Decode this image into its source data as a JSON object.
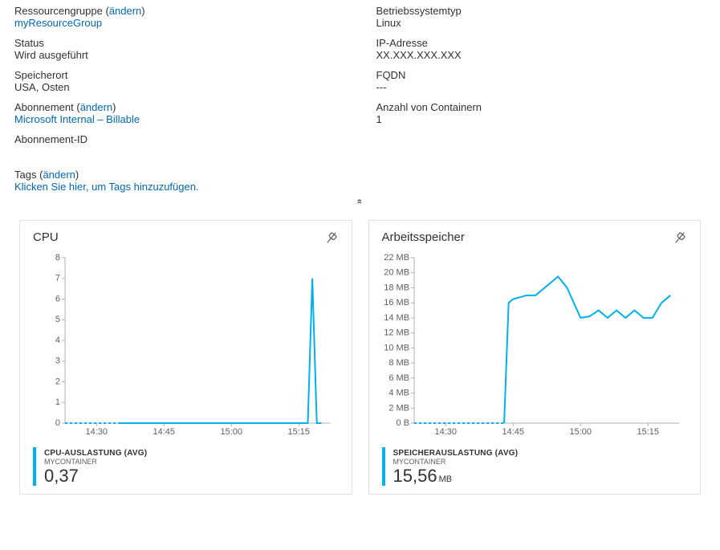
{
  "props_left": [
    {
      "label": "Ressourcengruppe",
      "action": "ändern",
      "value": "myResourceGroup",
      "valueIsLink": true
    },
    {
      "label": "Status",
      "value": "Wird ausgeführt"
    },
    {
      "label": "Speicherort",
      "value": "USA, Osten"
    },
    {
      "label": "Abonnement",
      "action": "ändern",
      "value": "Microsoft Internal – Billable",
      "valueIsLink": true
    },
    {
      "label": "Abonnement-ID",
      "value": " "
    }
  ],
  "props_right": [
    {
      "label": "Betriebssystemtyp",
      "value": "Linux"
    },
    {
      "label": "IP-Adresse",
      "value": "XX.XXX.XXX.XXX"
    },
    {
      "label": "FQDN",
      "value": "---"
    },
    {
      "label": "Anzahl von Containern",
      "value": "1"
    }
  ],
  "tags": {
    "label": "Tags",
    "action": "ändern",
    "cta": "Klicken Sie hier, um Tags hinzuzufügen."
  },
  "collapse_glyph": "«",
  "cards": {
    "cpu_title": "CPU",
    "mem_title": "Arbeitsspeicher"
  },
  "legend": {
    "cpu_metric": "CPU-AUSLASTUNG (AVG)",
    "cpu_sub": "MYCONTAINER",
    "cpu_value": "0,37",
    "mem_metric": "SPEICHERAUSLASTUNG (AVG)",
    "mem_sub": "MYCONTAINER",
    "mem_value": "15,56",
    "mem_unit": "MB"
  },
  "chart_data": [
    {
      "id": "cpu",
      "type": "line",
      "title": "CPU",
      "x_ticks": [
        "14:30",
        "14:45",
        "15:00",
        "15:15"
      ],
      "y_ticks": [
        0,
        1,
        2,
        3,
        4,
        5,
        6,
        7,
        8
      ],
      "ylim": [
        0,
        8
      ],
      "x": [
        "14:23",
        "14:25",
        "14:30",
        "14:35",
        "14:40",
        "14:45",
        "14:50",
        "14:55",
        "15:00",
        "15:05",
        "15:10",
        "15:15",
        "15:17",
        "15:18",
        "15:19",
        "15:20"
      ],
      "values": [
        0,
        0,
        0,
        0,
        0,
        0,
        0,
        0,
        0,
        0,
        0,
        0,
        0,
        7,
        0,
        0
      ],
      "dashed_until_index": 3,
      "series_name": "CPU-AUSLASTUNG (AVG)",
      "series_sub": "MYCONTAINER",
      "aggregate_value": "0,37"
    },
    {
      "id": "memory",
      "type": "line",
      "title": "Arbeitsspeicher",
      "x_ticks": [
        "14:30",
        "14:45",
        "15:00",
        "15:15"
      ],
      "y_ticks_labels": [
        "0 B",
        "2 MB",
        "4 MB",
        "6 MB",
        "8 MB",
        "10 MB",
        "12 MB",
        "14 MB",
        "16 MB",
        "18 MB",
        "20 MB",
        "22 MB"
      ],
      "y_ticks_values": [
        0,
        2,
        4,
        6,
        8,
        10,
        12,
        14,
        16,
        18,
        20,
        22
      ],
      "ylim": [
        0,
        22
      ],
      "unit": "MB",
      "x": [
        "14:23",
        "14:30",
        "14:35",
        "14:40",
        "14:43",
        "14:44",
        "14:45",
        "14:48",
        "14:50",
        "14:55",
        "14:57",
        "15:00",
        "15:02",
        "15:04",
        "15:06",
        "15:08",
        "15:10",
        "15:12",
        "15:14",
        "15:16",
        "15:18",
        "15:20"
      ],
      "values": [
        0,
        0,
        0,
        0,
        0,
        16,
        16.5,
        17,
        17,
        19.5,
        18,
        14,
        14.2,
        15,
        14,
        15,
        14,
        15,
        14,
        14,
        16,
        17
      ],
      "dashed_until_index": 4,
      "series_name": "SPEICHERAUSLASTUNG (AVG)",
      "series_sub": "MYCONTAINER",
      "aggregate_value": "15,56"
    }
  ],
  "chart_layout": {
    "times_axis": [
      "14:23",
      "14:30",
      "14:45",
      "15:00",
      "15:15",
      "15:22"
    ]
  }
}
